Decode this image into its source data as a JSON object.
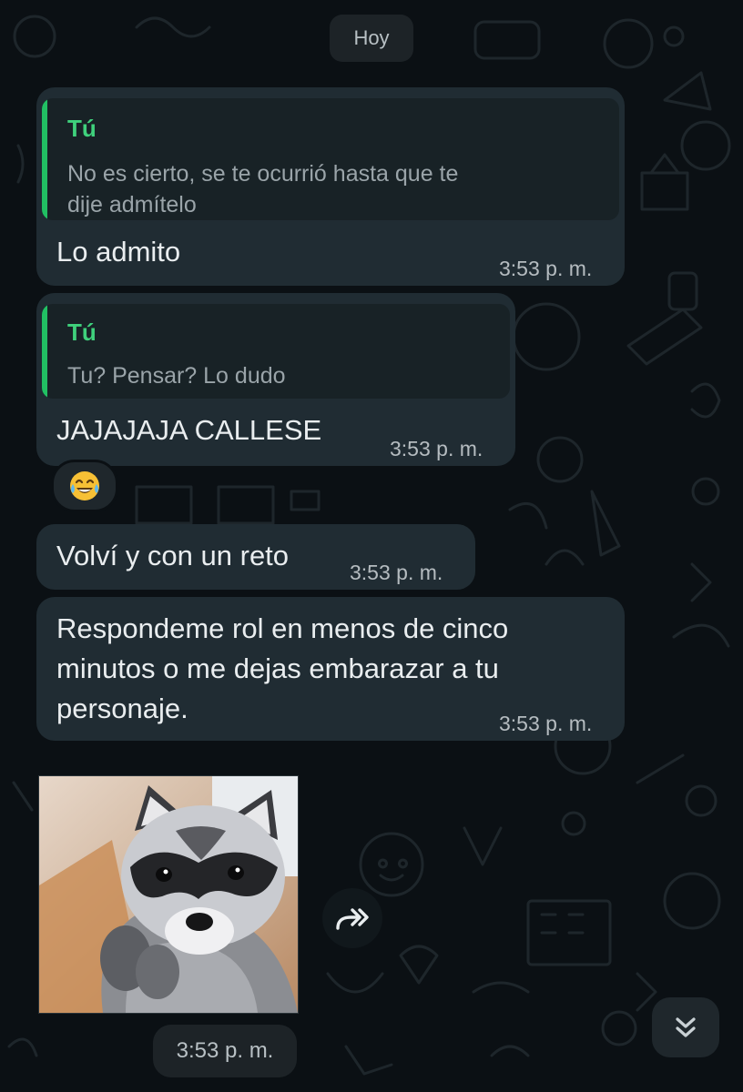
{
  "date_chip": "Hoy",
  "messages": [
    {
      "quote_author": "Tú",
      "quote_line1": "No es cierto, se te ocurrió hasta que te",
      "quote_line2": "dije admítelo",
      "text": "Lo admito",
      "time": "3:53 p. m."
    },
    {
      "quote_author": "Tú",
      "quote_line1": "Tu? Pensar? Lo dudo",
      "text": "JAJAJAJA CALLESE",
      "time": "3:53 p. m.",
      "reaction": "😂"
    },
    {
      "text": "Volví y con un reto",
      "time": "3:53 p. m."
    },
    {
      "line1": "Respondeme rol en menos de cinco",
      "line2": "minutos o me dejas embarazar a tu",
      "line3": "personaje.",
      "time": "3:53 p. m."
    }
  ],
  "sticker": {
    "icon": "raccoon-sticker",
    "time": "3:53 p. m."
  },
  "icons": {
    "forward": "forward-icon",
    "scroll_down": "double-chevron-down-icon"
  },
  "colors": {
    "background": "#0b1014",
    "bubble": "#202c33",
    "quote_bg": "#182226",
    "accent_green": "#21c063",
    "quote_author": "#3fd17c"
  }
}
